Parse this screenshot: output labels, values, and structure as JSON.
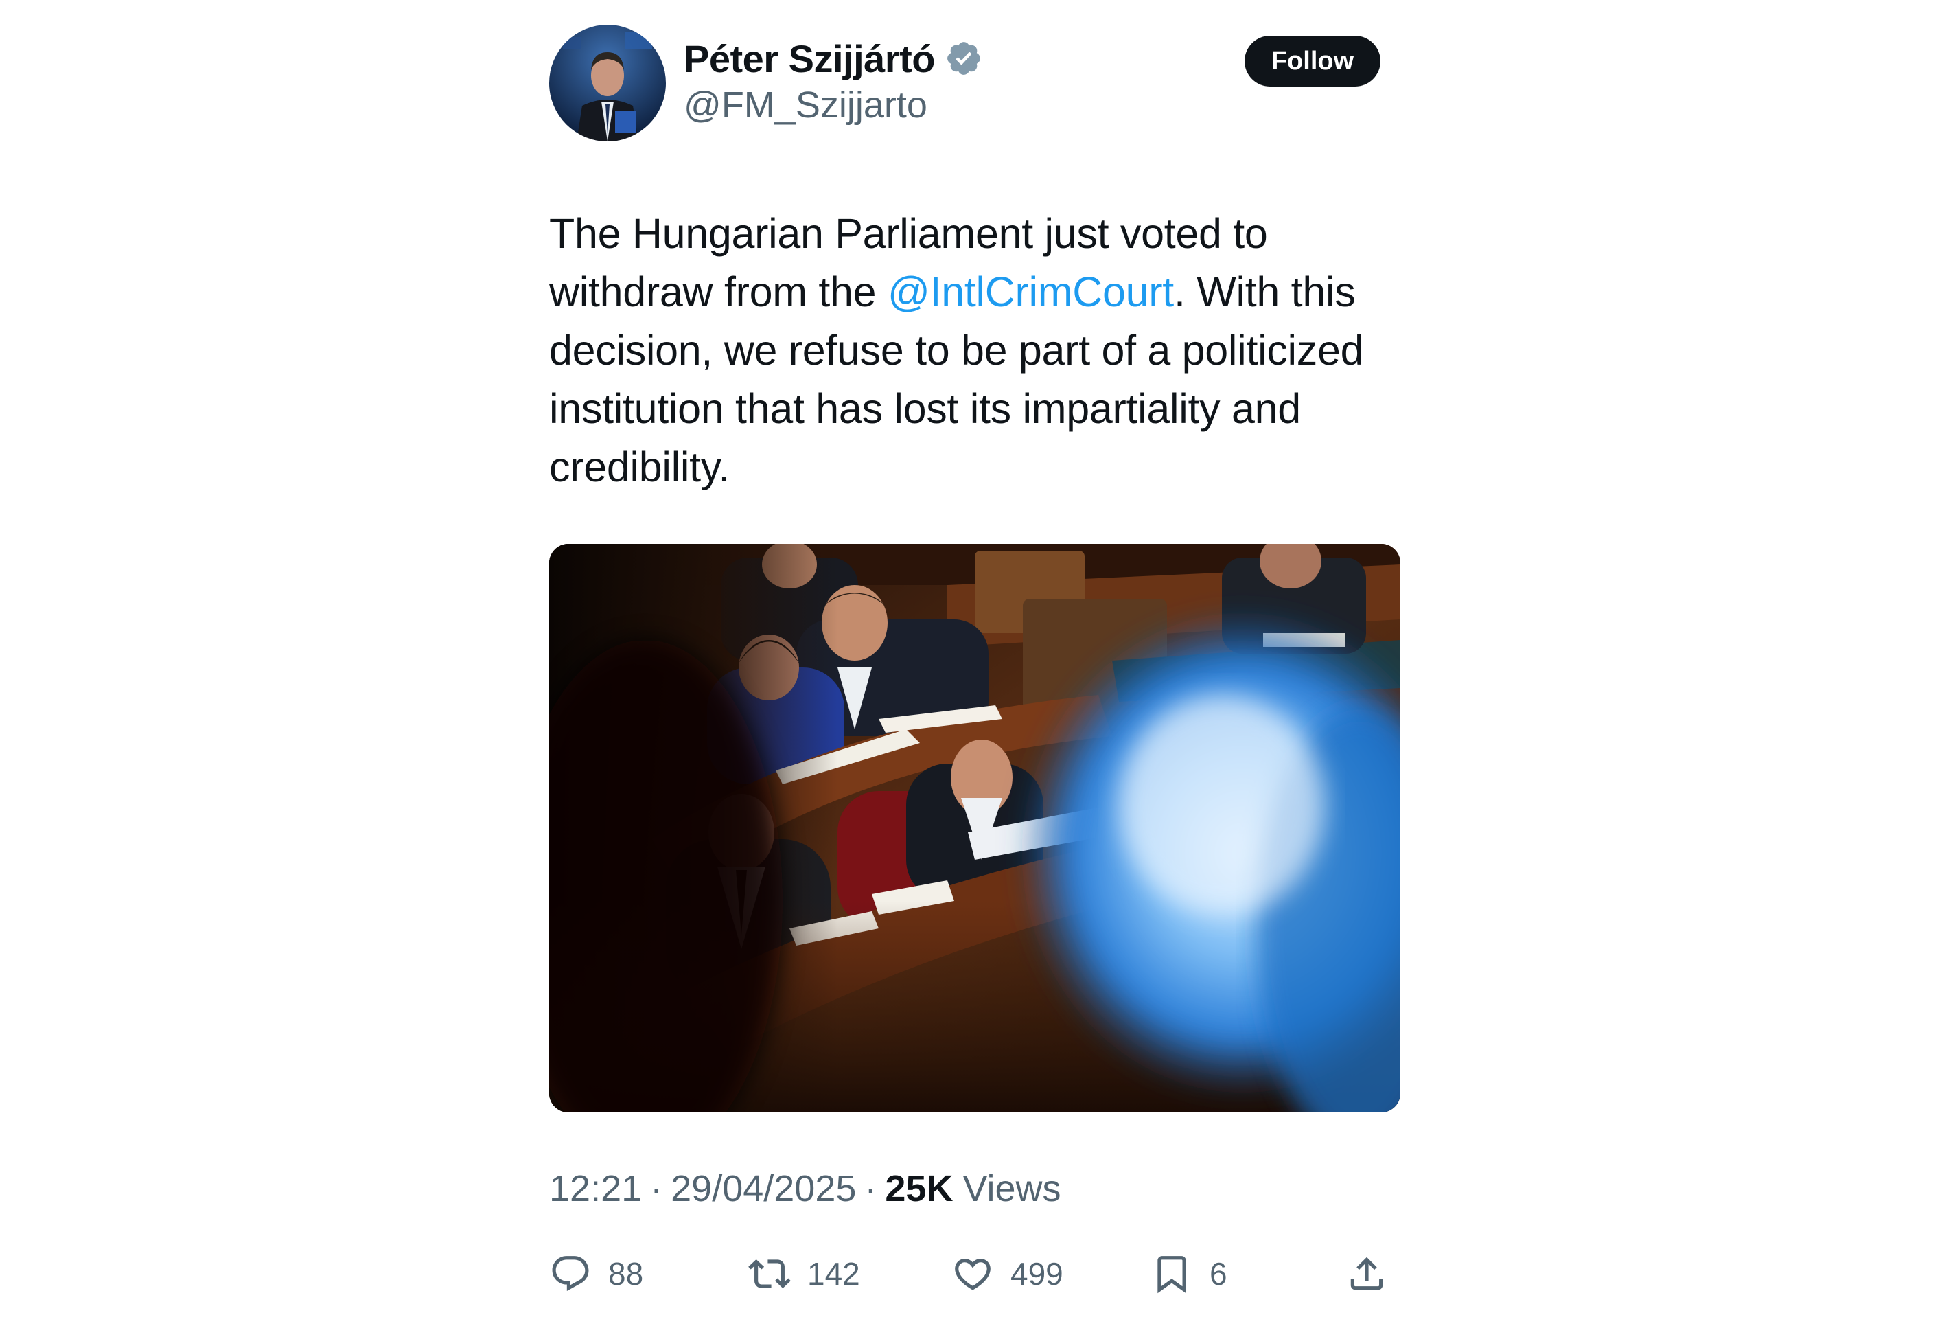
{
  "author": {
    "display_name": "Péter Szijjártó",
    "handle": "@FM_Szijjarto",
    "verified_icon": "verified-badge-icon"
  },
  "header": {
    "follow_label": "Follow"
  },
  "tweet": {
    "text_part1": "The Hungarian Parliament just voted to withdraw from the ",
    "mention": "@IntlCrimCourt",
    "text_part2": ". With this decision, we refuse to be part of a politicized institution that has lost its impartiality and credibility."
  },
  "meta": {
    "time": "12:21",
    "date": "29/04/2025",
    "separator": "·",
    "views_count": "25K",
    "views_label": "Views"
  },
  "actions": {
    "reply_count": "88",
    "retweet_count": "142",
    "like_count": "499",
    "bookmark_count": "6"
  },
  "colors": {
    "text": "#0f1419",
    "secondary": "#536471",
    "link": "#1d9bf0",
    "button_bg": "#0f1419"
  }
}
